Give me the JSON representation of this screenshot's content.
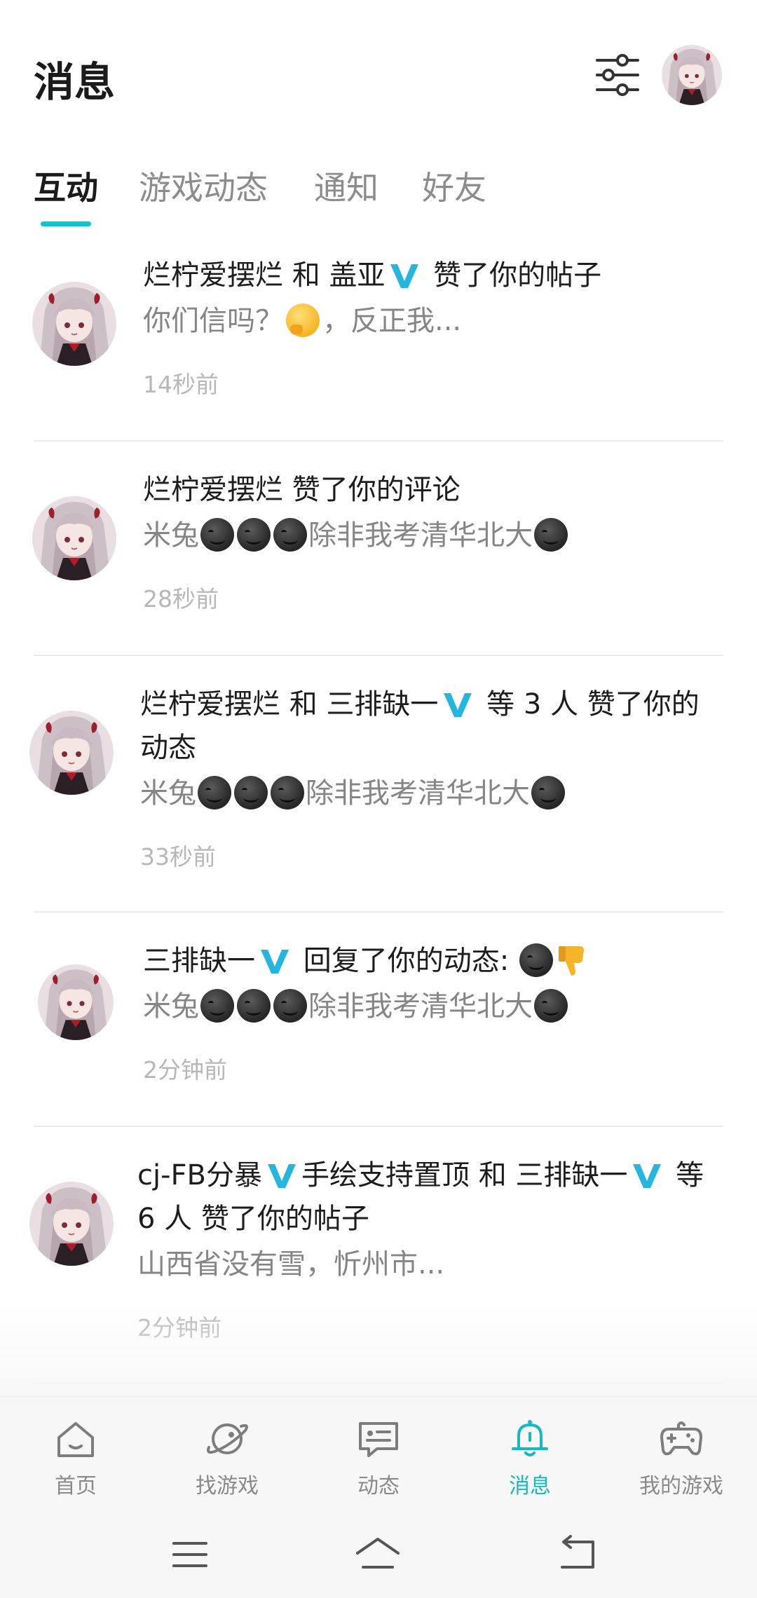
{
  "header": {
    "title": "消息"
  },
  "tabs": [
    {
      "label": "互动",
      "active": true
    },
    {
      "label": "游戏动态",
      "active": false
    },
    {
      "label": "通知",
      "active": false
    },
    {
      "label": "好友",
      "active": false
    }
  ],
  "colors": {
    "accent": "#16c1c9",
    "verified": "#25b6e0"
  },
  "items": [
    {
      "user1": "烂柠爱摆烂",
      "conj": "和",
      "user2": "盖亚",
      "action": "赞了你的帖子",
      "content_a": "你们信吗？",
      "content_b": "，反正我...",
      "time": "14秒前"
    },
    {
      "user1": "烂柠爱摆烂",
      "action": "赞了你的评论",
      "content_a": "米兔",
      "content_b": "除非我考清华北大",
      "time": "28秒前"
    },
    {
      "user1": "烂柠爱摆烂",
      "conj": "和",
      "user2": "三排缺一",
      "action": "等 3 人 赞了你的",
      "action2": "动态",
      "content_a": "米兔",
      "content_b": "除非我考清华北大",
      "time": "33秒前"
    },
    {
      "user1": "三排缺一",
      "action": "回复了你的动态:",
      "content_a": "米兔",
      "content_b": "除非我考清华北大",
      "time": "2分钟前"
    },
    {
      "user1": "cj-FB分暴",
      "user1b": "手绘支持置顶",
      "conj": "和",
      "user2": "三排缺一",
      "action": "等 6 人 赞了你的帖子",
      "content_a": "山西省没有雪，忻州市...",
      "time": "2分钟前"
    }
  ],
  "bottom_nav": [
    {
      "label": "首页",
      "icon": "home-icon",
      "active": false
    },
    {
      "label": "找游戏",
      "icon": "planet-icon",
      "active": false
    },
    {
      "label": "动态",
      "icon": "chat-icon",
      "active": false
    },
    {
      "label": "消息",
      "icon": "bell-icon",
      "active": true
    },
    {
      "label": "我的游戏",
      "icon": "gamepad-icon",
      "active": false
    }
  ]
}
